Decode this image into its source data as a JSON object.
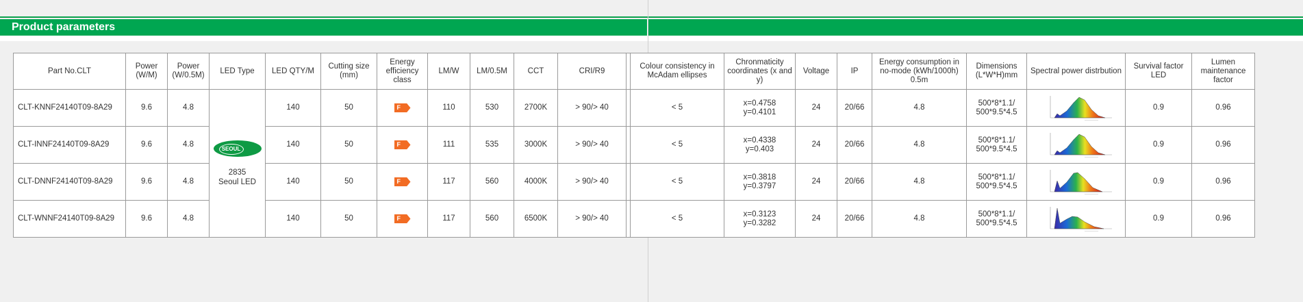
{
  "banner": {
    "title": "Product parameters"
  },
  "colors": {
    "brand_green": "#00a651",
    "badge_orange": "#f26c24",
    "logo_green": "#0e9a44"
  },
  "table": {
    "headers": [
      "Part No.CLT",
      "Power (W/M)",
      "Power (W/0.5M)",
      "LED Type",
      "LED QTY/M",
      "Cutting size (mm)",
      "Energy efficiency class",
      "LM/W",
      "LM/0.5M",
      "CCT",
      "CRI/R9",
      "",
      "Colour consistency in McAdam ellipses",
      "Chronmaticity coordinates (x and y)",
      "Voltage",
      "IP",
      "Energy consumption in no-mode (kWh/1000h) 0.5m",
      "Dimensions (L*W*H)mm",
      "Spectral power distrbution",
      "Survival factor LED",
      "Lumen maintenance factor"
    ],
    "led_type": {
      "logo_text": "SEOUL",
      "label_line1": "2835",
      "label_line2": "Seoul LED",
      "logo_icon": "seoul-logo-icon"
    },
    "rows": [
      {
        "part": "CLT-KNNF24140T09-8A29",
        "power_m": "9.6",
        "power_half": "4.8",
        "qty": "140",
        "cut": "50",
        "energy_class": "F",
        "lmw": "110",
        "lm_half": "530",
        "cct": "2700K",
        "cri": "> 90/> 40",
        "mcadam": "< 5",
        "cx": "x=0.4758",
        "cy": "y=0.4101",
        "voltage": "24",
        "ip": "20/66",
        "consumption": "4.8",
        "dim1": "500*8*1.1/",
        "dim2": "500*9.5*4.5",
        "survival": "0.9",
        "lumen": "0.96",
        "spectrum": "warm"
      },
      {
        "part": "CLT-INNF24140T09-8A29",
        "power_m": "9.6",
        "power_half": "4.8",
        "qty": "140",
        "cut": "50",
        "energy_class": "F",
        "lmw": "111",
        "lm_half": "535",
        "cct": "3000K",
        "cri": "> 90/> 40",
        "mcadam": "< 5",
        "cx": "x=0.4338",
        "cy": "y=0.403",
        "voltage": "24",
        "ip": "20/66",
        "consumption": "4.8",
        "dim1": "500*8*1.1/",
        "dim2": "500*9.5*4.5",
        "survival": "0.9",
        "lumen": "0.96",
        "spectrum": "warm"
      },
      {
        "part": "CLT-DNNF24140T09-8A29",
        "power_m": "9.6",
        "power_half": "4.8",
        "qty": "140",
        "cut": "50",
        "energy_class": "F",
        "lmw": "117",
        "lm_half": "560",
        "cct": "4000K",
        "cri": "> 90/> 40",
        "mcadam": "< 5",
        "cx": "x=0.3818",
        "cy": "y=0.3797",
        "voltage": "24",
        "ip": "20/66",
        "consumption": "4.8",
        "dim1": "500*8*1.1/",
        "dim2": "500*9.5*4.5",
        "survival": "0.9",
        "lumen": "0.96",
        "spectrum": "neutral"
      },
      {
        "part": "CLT-WNNF24140T09-8A29",
        "power_m": "9.6",
        "power_half": "4.8",
        "qty": "140",
        "cut": "50",
        "energy_class": "F",
        "lmw": "117",
        "lm_half": "560",
        "cct": "6500K",
        "cri": "> 90/> 40",
        "mcadam": "< 5",
        "cx": "x=0.3123",
        "cy": "y=0.3282",
        "voltage": "24",
        "ip": "20/66",
        "consumption": "4.8",
        "dim1": "500*8*1.1/",
        "dim2": "500*9.5*4.5",
        "survival": "0.9",
        "lumen": "0.96",
        "spectrum": "cool"
      }
    ]
  }
}
